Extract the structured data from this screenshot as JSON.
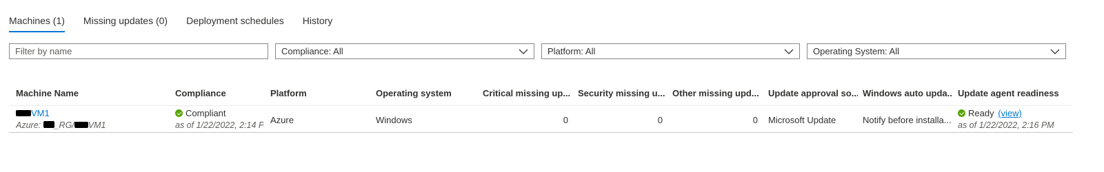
{
  "tabs": [
    {
      "label": "Machines (1)",
      "active": true
    },
    {
      "label": "Missing updates (0)",
      "active": false
    },
    {
      "label": "Deployment schedules",
      "active": false
    },
    {
      "label": "History",
      "active": false
    }
  ],
  "filters": {
    "name_placeholder": "Filter by name",
    "compliance": "Compliance: All",
    "platform": "Platform: All",
    "os": "Operating System: All"
  },
  "table": {
    "columns": [
      "Machine Name",
      "Compliance",
      "Platform",
      "Operating system",
      "Critical missing up...",
      "Security missing u...",
      "Other missing upd...",
      "Update approval so...",
      "Windows auto upda...",
      "Update agent readiness"
    ],
    "rows": [
      {
        "machine_name_suffix": "VM1",
        "machine_sub_prefix": "Azure: ",
        "machine_sub_mid": "_RG/",
        "machine_sub_suffix": "VM1",
        "compliance": "Compliant",
        "compliance_time": "as of 1/22/2022, 2:14 P",
        "platform": "Azure",
        "os": "Windows",
        "critical": "0",
        "security": "0",
        "other": "0",
        "approval_source": "Microsoft Update",
        "windows_auto_update": "Notify before installa...",
        "readiness": "Ready",
        "readiness_link": "(view)",
        "readiness_time": "as of 1/22/2022, 2:16 PM"
      }
    ]
  },
  "colors": {
    "accent": "#0078d4",
    "success": "#57a300"
  },
  "icons": [
    "chevron-down-icon",
    "check-circle-icon"
  ]
}
